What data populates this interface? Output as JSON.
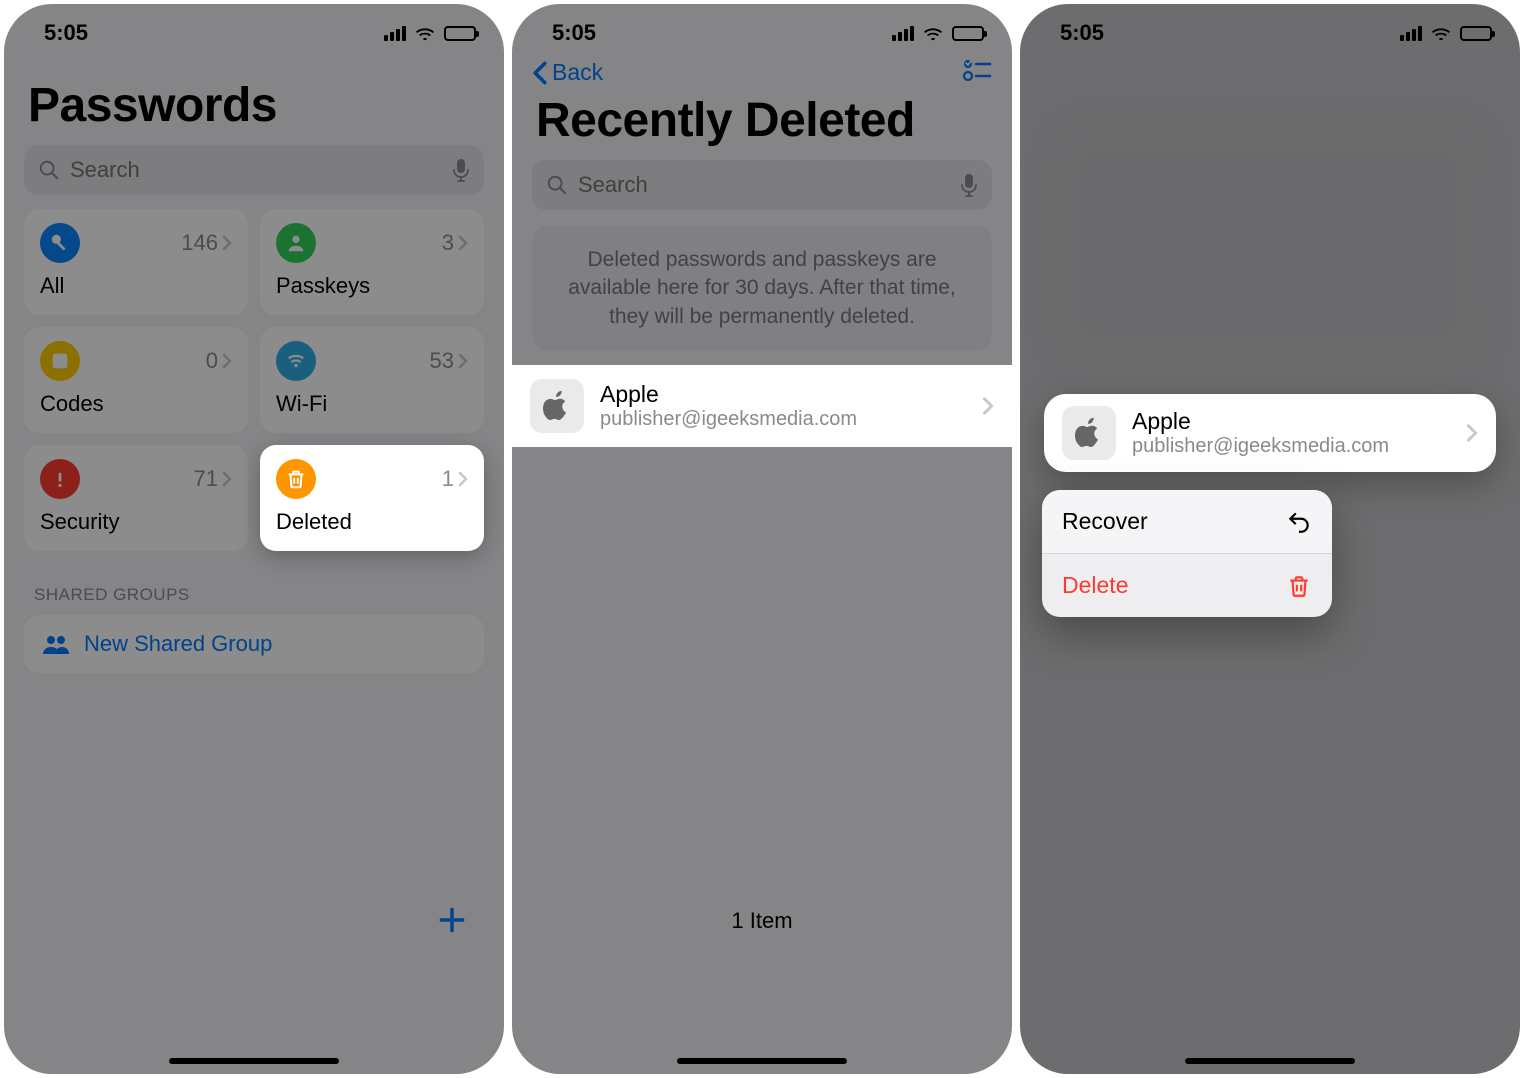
{
  "status": {
    "time": "5:05"
  },
  "panel1": {
    "title": "Passwords",
    "search_placeholder": "Search",
    "tiles": {
      "all": {
        "label": "All",
        "count": "146"
      },
      "passkeys": {
        "label": "Passkeys",
        "count": "3"
      },
      "codes": {
        "label": "Codes",
        "count": "0"
      },
      "wifi": {
        "label": "Wi-Fi",
        "count": "53"
      },
      "security": {
        "label": "Security",
        "count": "71"
      },
      "deleted": {
        "label": "Deleted",
        "count": "1"
      }
    },
    "shared_groups_label": "SHARED GROUPS",
    "new_shared_group": "New Shared Group"
  },
  "panel2": {
    "back_label": "Back",
    "title": "Recently Deleted",
    "search_placeholder": "Search",
    "banner": "Deleted passwords and passkeys are available here for 30 days. After that time, they will be permanently deleted.",
    "item": {
      "name": "Apple",
      "detail": "publisher@igeeksmedia.com"
    },
    "footer": "1 Item"
  },
  "panel3": {
    "item": {
      "name": "Apple",
      "detail": "publisher@igeeksmedia.com"
    },
    "menu": {
      "recover": "Recover",
      "delete": "Delete"
    }
  }
}
